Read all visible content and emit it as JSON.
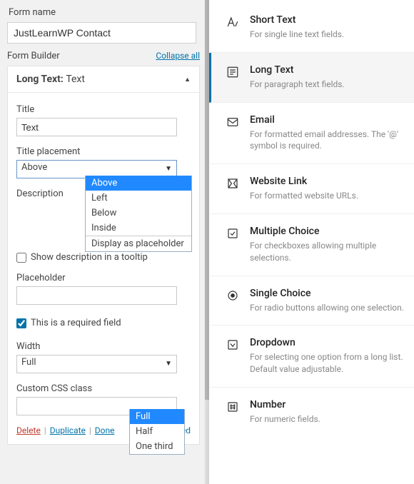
{
  "form_name_label": "Form name",
  "form_name_value": "JustLearnWP Contact",
  "builder_label": "Form Builder",
  "collapse_all": "Collapse all",
  "panel_title_prefix": "Long Text: ",
  "panel_title_value": "Text",
  "labels": {
    "title": "Title",
    "title_placement": "Title placement",
    "description": "Description",
    "placeholder": "Placeholder",
    "width": "Width",
    "custom_css": "Custom CSS class"
  },
  "values": {
    "title": "Text",
    "title_placement": "Above",
    "width": "Full"
  },
  "title_placement_options": [
    "Above",
    "Left",
    "Below",
    "Inside",
    "Display as placeholder"
  ],
  "width_options": [
    "Full",
    "Half",
    "One third"
  ],
  "checkboxes": {
    "show_tooltip": "Show description in a tooltip",
    "required": "This is a required field"
  },
  "footer": {
    "delete": "Delete",
    "duplicate": "Duplicate",
    "done": "Done",
    "advanced": "Advanced"
  },
  "field_types": [
    {
      "title": "Short Text",
      "desc": "For single line text fields."
    },
    {
      "title": "Long Text",
      "desc": "For paragraph text fields."
    },
    {
      "title": "Email",
      "desc": "For formatted email addresses. The '@' symbol is required."
    },
    {
      "title": "Website Link",
      "desc": "For formatted website URLs."
    },
    {
      "title": "Multiple Choice",
      "desc": "For checkboxes allowing multiple selections."
    },
    {
      "title": "Single Choice",
      "desc": "For radio buttons allowing one selection."
    },
    {
      "title": "Dropdown",
      "desc": "For selecting one option from a long list. Default value adjustable."
    },
    {
      "title": "Number",
      "desc": "For numeric fields."
    }
  ]
}
